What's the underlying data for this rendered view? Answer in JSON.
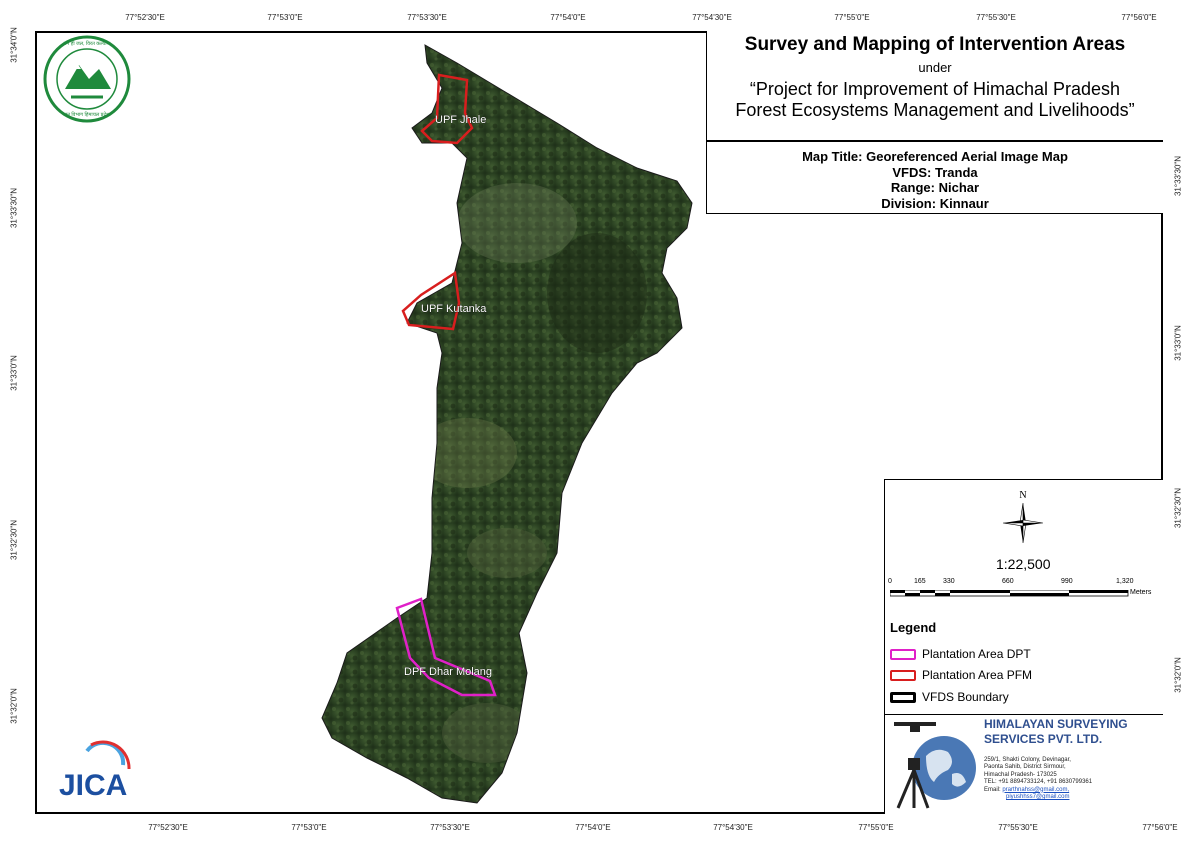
{
  "title": {
    "main": "Survey and Mapping of Intervention Areas",
    "under": "under",
    "project_line1": "“Project for Improvement of Himachal Pradesh",
    "project_line2": "Forest Ecosystems Management and Livelihoods”"
  },
  "info": {
    "map_title": "Map Title: Georeferenced Aerial Image Map",
    "vfds": "VFDS: Tranda",
    "range": "Range: Nichar",
    "division": "Division: Kinnaur"
  },
  "grid": {
    "longitudes": [
      "77°52'30\"E",
      "77°53'0\"E",
      "77°53'30\"E",
      "77°54'0\"E",
      "77°54'30\"E",
      "77°55'0\"E",
      "77°55'30\"E",
      "77°56'0\"E"
    ],
    "latitudes": [
      "31°34'0\"N",
      "31°33'30\"N",
      "31°33'0\"N",
      "31°32'30\"N",
      "31°32'0\"N"
    ]
  },
  "scale": {
    "north_label": "N",
    "ratio": "1:22,500",
    "ticks": [
      "0",
      "165",
      "330",
      "660",
      "990",
      "1,320"
    ],
    "unit": "Meters"
  },
  "legend": {
    "title": "Legend",
    "items": [
      {
        "label": "Plantation Area DPT",
        "color": "#e020c8"
      },
      {
        "label": "Plantation Area PFM",
        "color": "#d81e1e"
      },
      {
        "label": "VFDS Boundary",
        "color": "#000000"
      }
    ]
  },
  "map_labels": {
    "upf_jhale": "UPF Jhale",
    "upf_kutanka": "UPF Kutanka",
    "dpf_dhar_molang": "DPF Dhar Molang"
  },
  "logos": {
    "forest_dept_text": "वन ही जल, विरत कल्याण",
    "forest_dept_sub": "वन विभाग हिमाचल प्रदेश",
    "jica": "JICA"
  },
  "company": {
    "name_line1": "HIMALAYAN SURVEYING",
    "name_line2": "SERVICES PVT. LTD.",
    "address_lines": [
      "259/1, Shakti Colony, Devinagar,",
      "Paonta Sahib, District Sirmour,",
      "Himachal Pradesh- 173025",
      "TEL: +91 8894733124, +91 8630799361"
    ],
    "email_prefix": "Email: ",
    "email1": "prarthnahss@gmail.com,",
    "email2": "piyushhss7@gmail.com"
  }
}
